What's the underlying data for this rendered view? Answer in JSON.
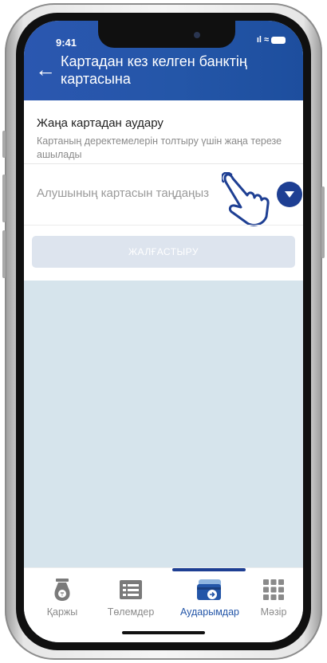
{
  "status_bar": {
    "time": "9:41",
    "signal": "ıl",
    "wifi": "≈"
  },
  "header": {
    "title": "Картадан кез келген банктің картасына"
  },
  "new_card": {
    "title": "Жаңа картадан аудару",
    "subtitle": "Картаның деректемелерін толтыру үшін жаңа терезе ашылады"
  },
  "recipient_select": {
    "placeholder": "Алушының картасын таңдаңыз"
  },
  "continue_button": {
    "label": "ЖАЛҒАСТЫРУ"
  },
  "tabbar": {
    "items": [
      {
        "label": "Қаржы",
        "icon": "money-bag-icon",
        "active": false
      },
      {
        "label": "Төлемдер",
        "icon": "payments-icon",
        "active": false
      },
      {
        "label": "Аударымдар",
        "icon": "transfer-card-icon",
        "active": true
      },
      {
        "label": "Мәзір",
        "icon": "grid-menu-icon",
        "active": false
      }
    ]
  },
  "colors": {
    "header": "#2456a8",
    "accent": "#1e3f93",
    "background": "#d6e4ec",
    "button_disabled": "#dde4ee"
  }
}
